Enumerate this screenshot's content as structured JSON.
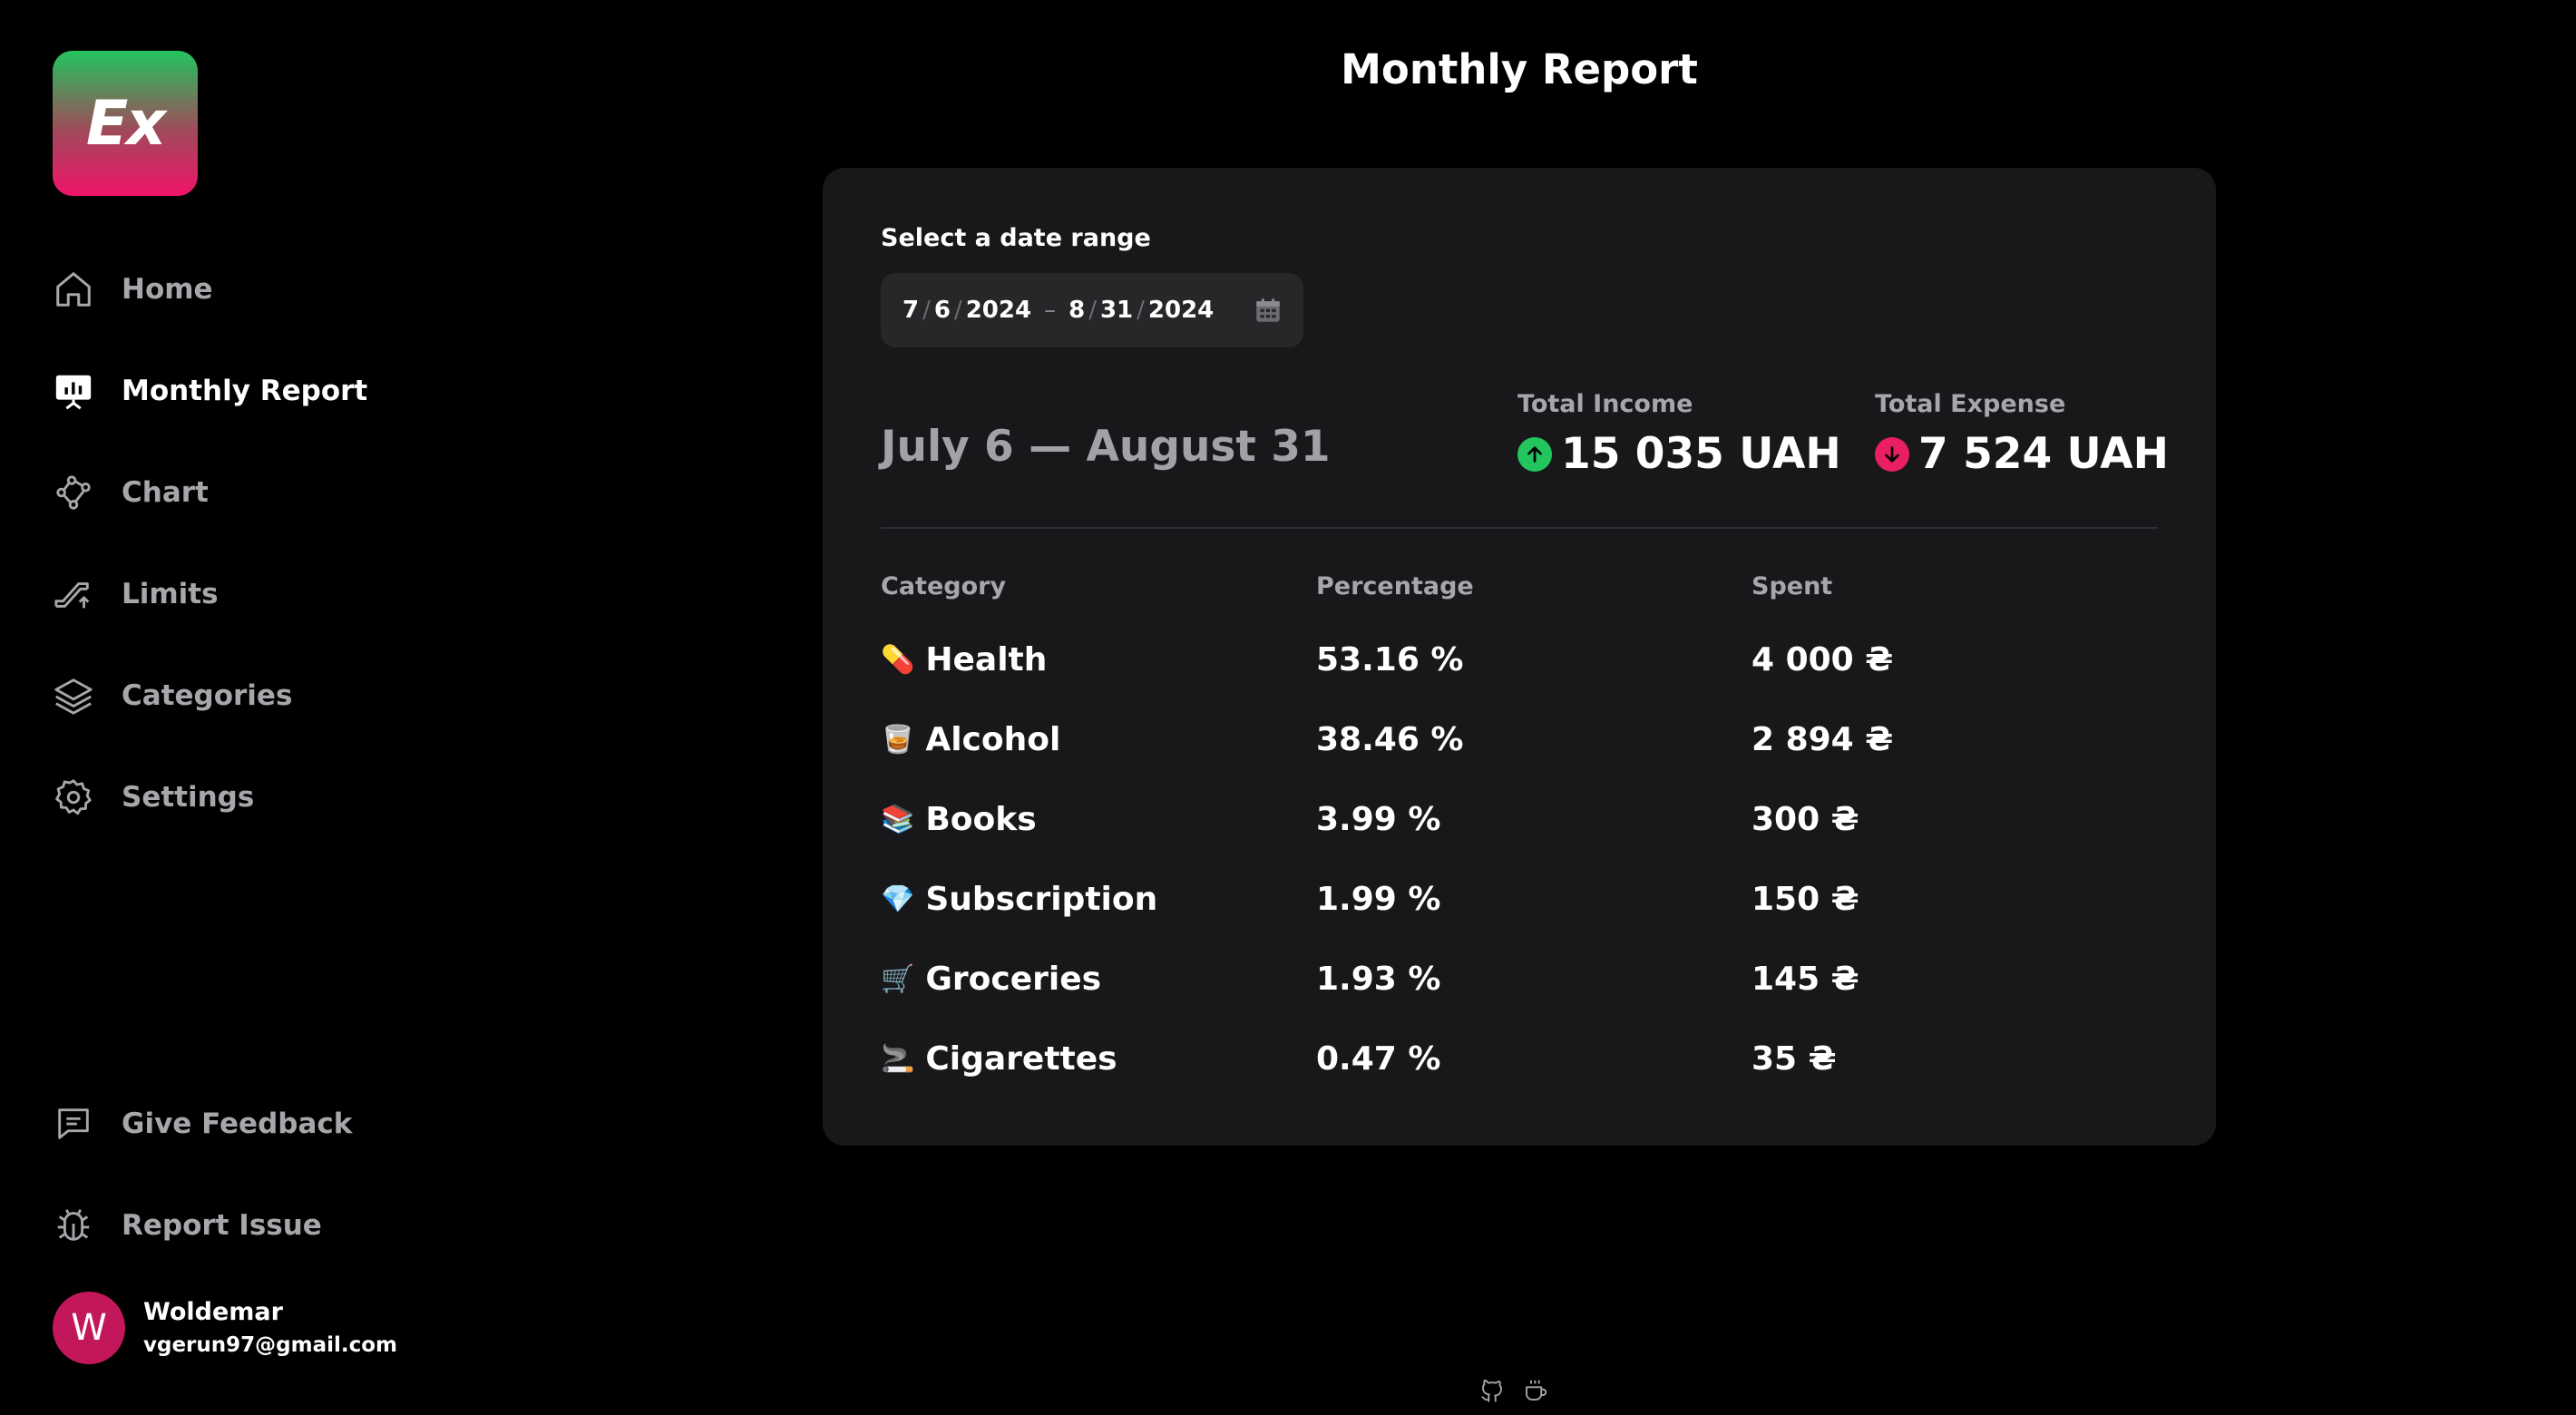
{
  "sidebar": {
    "logo_text": "Ex",
    "items": [
      {
        "label": "Home",
        "icon": "home-icon"
      },
      {
        "label": "Monthly Report",
        "icon": "presentation-chart-icon"
      },
      {
        "label": "Chart",
        "icon": "chart-nodes-icon"
      },
      {
        "label": "Limits",
        "icon": "limits-ramp-icon"
      },
      {
        "label": "Categories",
        "icon": "layers-icon"
      },
      {
        "label": "Settings",
        "icon": "gear-icon"
      }
    ],
    "bottom_items": [
      {
        "label": "Give Feedback",
        "icon": "message-icon"
      },
      {
        "label": "Report Issue",
        "icon": "bug-icon"
      }
    ],
    "user": {
      "initial": "W",
      "name": "Woldemar",
      "email": "vgerun97@gmail.com"
    }
  },
  "header": {
    "title": "Monthly Report"
  },
  "report": {
    "date_label": "Select a date range",
    "date_range": {
      "start_month": "7",
      "start_day": "6",
      "start_year": "2024",
      "end_month": "8",
      "end_day": "31",
      "end_year": "2024"
    },
    "range_title": "July 6 — August 31",
    "total_income_label": "Total Income",
    "total_income": "15 035 UAH",
    "total_expense_label": "Total Expense",
    "total_expense": "7 524 UAH",
    "colors": {
      "income": "#22c55e",
      "expense": "#e91e63"
    },
    "columns": [
      "Category",
      "Percentage",
      "Spent"
    ],
    "rows": [
      {
        "emoji": "💊",
        "category": "Health",
        "percentage": "53.16 %",
        "spent": "4 000 ₴"
      },
      {
        "emoji": "🥃",
        "category": "Alcohol",
        "percentage": "38.46 %",
        "spent": "2 894 ₴"
      },
      {
        "emoji": "📚",
        "category": "Books",
        "percentage": "3.99 %",
        "spent": "300 ₴"
      },
      {
        "emoji": "💎",
        "category": "Subscription",
        "percentage": "1.99 %",
        "spent": "150 ₴"
      },
      {
        "emoji": "🛒",
        "category": "Groceries",
        "percentage": "1.93 %",
        "spent": "145 ₴"
      },
      {
        "emoji": "🚬",
        "category": "Cigarettes",
        "percentage": "0.47 %",
        "spent": "35 ₴"
      }
    ]
  },
  "footer": {
    "icons": [
      "github-icon",
      "coffee-icon"
    ]
  }
}
